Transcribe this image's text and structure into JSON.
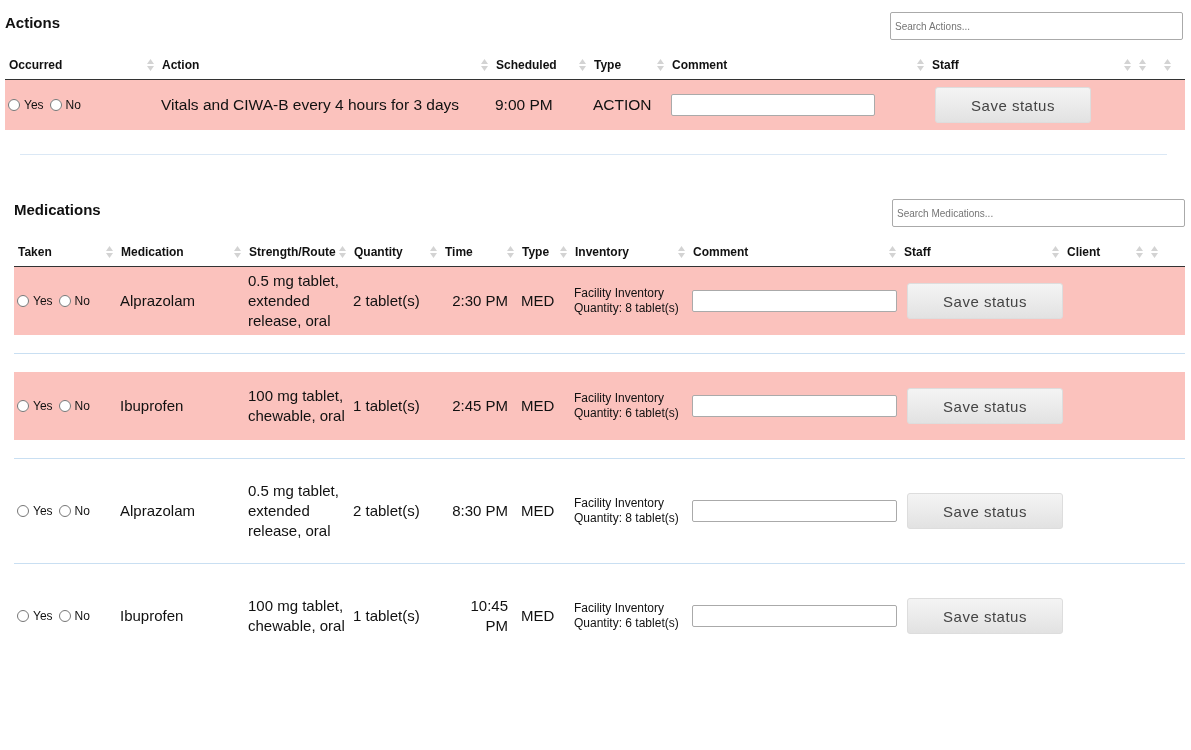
{
  "actions": {
    "title": "Actions",
    "search": {
      "placeholder": "Search Actions..."
    },
    "columns": [
      {
        "label": "Occurred"
      },
      {
        "label": "Action"
      },
      {
        "label": "Scheduled"
      },
      {
        "label": "Type"
      },
      {
        "label": "Comment"
      },
      {
        "label": "Staff"
      },
      {},
      {}
    ],
    "rows": [
      {
        "highlighted": true,
        "options": [
          {
            "label": "Yes",
            "selected": false
          },
          {
            "label": "No",
            "selected": false
          }
        ],
        "action": "Vitals and CIWA-B every 4 hours for 3 days",
        "scheduled": "9:00 PM",
        "type": "ACTION",
        "button": "Save status"
      }
    ]
  },
  "medications": {
    "title": "Medications",
    "search": {
      "placeholder": "Search Medications..."
    },
    "columns": [
      {
        "label": "Taken"
      },
      {
        "label": "Medication"
      },
      {
        "label": "Strength/Route"
      },
      {
        "label": "Quantity"
      },
      {
        "label": "Time"
      },
      {
        "label": "Type"
      },
      {
        "label": "Inventory"
      },
      {
        "label": "Comment"
      },
      {
        "label": "Staff"
      },
      {
        "label": "Client"
      },
      {}
    ],
    "rows": [
      {
        "highlighted": true,
        "options": [
          {
            "label": "Yes",
            "selected": false
          },
          {
            "label": "No",
            "selected": false
          }
        ],
        "medication": "Alprazolam",
        "strength": "0.5 mg tablet, extended release, oral",
        "quantity": "2 tablet(s)",
        "time": "2:30 PM",
        "type": "MED",
        "inventory": [
          "Facility Inventory",
          "Quantity: 8 tablet(s)"
        ],
        "button": "Save status"
      },
      {
        "highlighted": true,
        "options": [
          {
            "label": "Yes",
            "selected": false
          },
          {
            "label": "No",
            "selected": false
          }
        ],
        "medication": "Ibuprofen",
        "strength": "100 mg tablet, chewable, oral",
        "quantity": "1 tablet(s)",
        "time": "2:45 PM",
        "type": "MED",
        "inventory": [
          "Facility Inventory",
          "Quantity: 6 tablet(s)"
        ],
        "button": "Save status"
      },
      {
        "highlighted": false,
        "options": [
          {
            "label": "Yes",
            "selected": false
          },
          {
            "label": "No",
            "selected": false
          }
        ],
        "medication": "Alprazolam",
        "strength": "0.5 mg tablet, extended release, oral",
        "quantity": "2 tablet(s)",
        "time": "8:30 PM",
        "type": "MED",
        "inventory": [
          "Facility Inventory",
          "Quantity: 8 tablet(s)"
        ],
        "button": "Save status"
      },
      {
        "highlighted": false,
        "options": [
          {
            "label": "Yes",
            "selected": false
          },
          {
            "label": "No",
            "selected": false
          }
        ],
        "medication": "Ibuprofen",
        "strength": "100 mg tablet, chewable, oral",
        "quantity": "1 tablet(s)",
        "time": "10:45 PM",
        "type": "MED",
        "inventory": [
          "Facility Inventory",
          "Quantity: 6 tablet(s)"
        ],
        "button": "Save status"
      }
    ]
  }
}
